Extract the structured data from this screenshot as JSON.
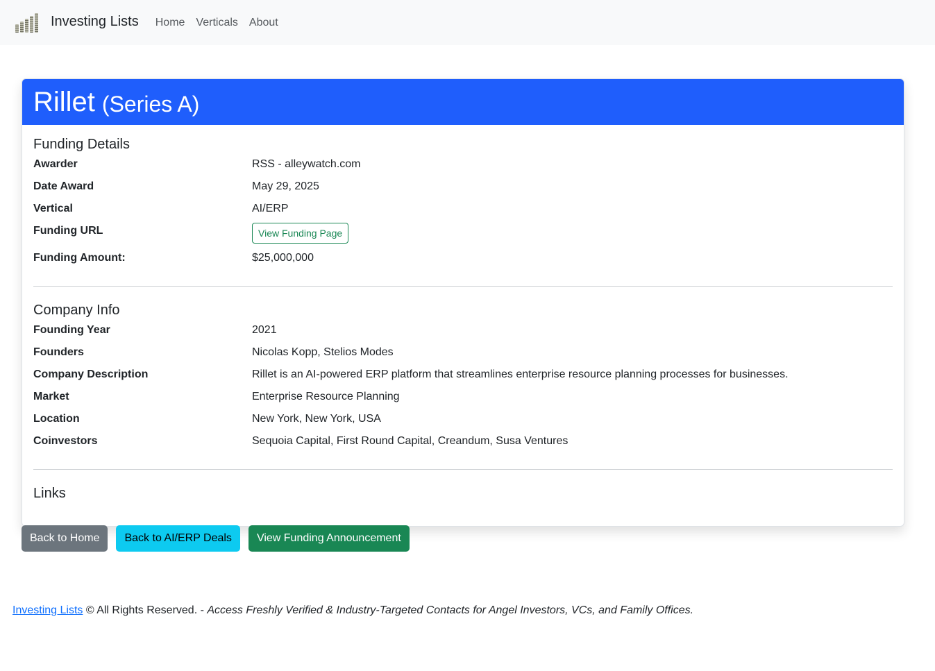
{
  "nav": {
    "brand": "Investing Lists",
    "links": [
      "Home",
      "Verticals",
      "About"
    ]
  },
  "deal": {
    "company": "Rillet",
    "round": "(Series A)"
  },
  "funding": {
    "title": "Funding Details",
    "rows": [
      {
        "label": "Awarder",
        "value": "RSS - alleywatch.com"
      },
      {
        "label": "Date Award",
        "value": "May 29, 2025"
      },
      {
        "label": "Vertical",
        "value": "AI/ERP"
      },
      {
        "label": "Funding URL",
        "button": "View Funding Page"
      },
      {
        "label": "Funding Amount:",
        "value": "$25,000,000"
      }
    ]
  },
  "company": {
    "title": "Company Info",
    "rows": [
      {
        "label": "Founding Year",
        "value": "2021"
      },
      {
        "label": "Founders",
        "value": "Nicolas Kopp, Stelios Modes"
      },
      {
        "label": "Company Description",
        "value": "Rillet is an AI-powered ERP platform that streamlines enterprise resource planning processes for businesses."
      },
      {
        "label": "Market",
        "value": "Enterprise Resource Planning"
      },
      {
        "label": "Location",
        "value": "New York, New York, USA"
      },
      {
        "label": "Coinvestors",
        "value": "Sequoia Capital, First Round Capital, Creandum, Susa Ventures"
      }
    ]
  },
  "links": {
    "title": "Links"
  },
  "actions": {
    "back_home": "Back to Home",
    "back_vertical": "Back to AI/ERP Deals",
    "view_announcement": "View Funding Announcement"
  },
  "footer": {
    "link": "Investing Lists",
    "rights": " © All Rights Reserved. - ",
    "tagline": "Access Freshly Verified & Industry-Targeted Contacts for Angel Investors, VCs, and Family Offices."
  },
  "colors": {
    "header": "#1f5efc",
    "success": "#198754",
    "info": "#0dcaf0",
    "secondary": "#6c757d"
  }
}
